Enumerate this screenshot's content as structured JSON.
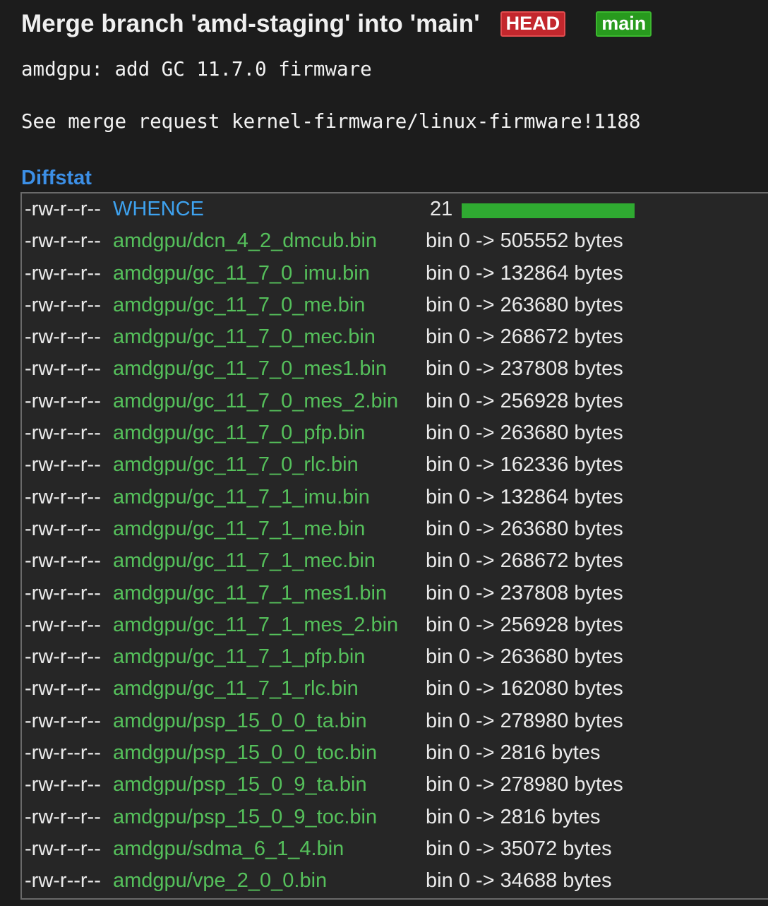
{
  "commit": {
    "title": "Merge branch 'amd-staging' into 'main'",
    "refs": [
      {
        "label": "HEAD",
        "color": "#c3272d"
      },
      {
        "label": "main",
        "color": "#289a1e"
      }
    ],
    "message": "amdgpu: add GC 11.7.0 firmware\n\nSee merge request kernel-firmware/linux-firmware!1188"
  },
  "diffstat": {
    "heading": "Diffstat",
    "bar_color": "#2faa31",
    "files": [
      {
        "mode": "-rw-r--r--",
        "path": "WHENCE",
        "stat": "21",
        "kind": "modified",
        "added_fraction": 1.0
      },
      {
        "mode": "-rw-r--r--",
        "path": "amdgpu/dcn_4_2_dmcub.bin",
        "stat": "bin 0 -> 505552 bytes",
        "kind": "binary"
      },
      {
        "mode": "-rw-r--r--",
        "path": "amdgpu/gc_11_7_0_imu.bin",
        "stat": "bin 0 -> 132864 bytes",
        "kind": "binary"
      },
      {
        "mode": "-rw-r--r--",
        "path": "amdgpu/gc_11_7_0_me.bin",
        "stat": "bin 0 -> 263680 bytes",
        "kind": "binary"
      },
      {
        "mode": "-rw-r--r--",
        "path": "amdgpu/gc_11_7_0_mec.bin",
        "stat": "bin 0 -> 268672 bytes",
        "kind": "binary"
      },
      {
        "mode": "-rw-r--r--",
        "path": "amdgpu/gc_11_7_0_mes1.bin",
        "stat": "bin 0 -> 237808 bytes",
        "kind": "binary"
      },
      {
        "mode": "-rw-r--r--",
        "path": "amdgpu/gc_11_7_0_mes_2.bin",
        "stat": "bin 0 -> 256928 bytes",
        "kind": "binary"
      },
      {
        "mode": "-rw-r--r--",
        "path": "amdgpu/gc_11_7_0_pfp.bin",
        "stat": "bin 0 -> 263680 bytes",
        "kind": "binary"
      },
      {
        "mode": "-rw-r--r--",
        "path": "amdgpu/gc_11_7_0_rlc.bin",
        "stat": "bin 0 -> 162336 bytes",
        "kind": "binary"
      },
      {
        "mode": "-rw-r--r--",
        "path": "amdgpu/gc_11_7_1_imu.bin",
        "stat": "bin 0 -> 132864 bytes",
        "kind": "binary"
      },
      {
        "mode": "-rw-r--r--",
        "path": "amdgpu/gc_11_7_1_me.bin",
        "stat": "bin 0 -> 263680 bytes",
        "kind": "binary"
      },
      {
        "mode": "-rw-r--r--",
        "path": "amdgpu/gc_11_7_1_mec.bin",
        "stat": "bin 0 -> 268672 bytes",
        "kind": "binary"
      },
      {
        "mode": "-rw-r--r--",
        "path": "amdgpu/gc_11_7_1_mes1.bin",
        "stat": "bin 0 -> 237808 bytes",
        "kind": "binary"
      },
      {
        "mode": "-rw-r--r--",
        "path": "amdgpu/gc_11_7_1_mes_2.bin",
        "stat": "bin 0 -> 256928 bytes",
        "kind": "binary"
      },
      {
        "mode": "-rw-r--r--",
        "path": "amdgpu/gc_11_7_1_pfp.bin",
        "stat": "bin 0 -> 263680 bytes",
        "kind": "binary"
      },
      {
        "mode": "-rw-r--r--",
        "path": "amdgpu/gc_11_7_1_rlc.bin",
        "stat": "bin 0 -> 162080 bytes",
        "kind": "binary"
      },
      {
        "mode": "-rw-r--r--",
        "path": "amdgpu/psp_15_0_0_ta.bin",
        "stat": "bin 0 -> 278980 bytes",
        "kind": "binary"
      },
      {
        "mode": "-rw-r--r--",
        "path": "amdgpu/psp_15_0_0_toc.bin",
        "stat": "bin 0 -> 2816 bytes",
        "kind": "binary"
      },
      {
        "mode": "-rw-r--r--",
        "path": "amdgpu/psp_15_0_9_ta.bin",
        "stat": "bin 0 -> 278980 bytes",
        "kind": "binary"
      },
      {
        "mode": "-rw-r--r--",
        "path": "amdgpu/psp_15_0_9_toc.bin",
        "stat": "bin 0 -> 2816 bytes",
        "kind": "binary"
      },
      {
        "mode": "-rw-r--r--",
        "path": "amdgpu/sdma_6_1_4.bin",
        "stat": "bin 0 -> 35072 bytes",
        "kind": "binary"
      },
      {
        "mode": "-rw-r--r--",
        "path": "amdgpu/vpe_2_0_0.bin",
        "stat": "bin 0 -> 34688 bytes",
        "kind": "binary"
      }
    ]
  }
}
